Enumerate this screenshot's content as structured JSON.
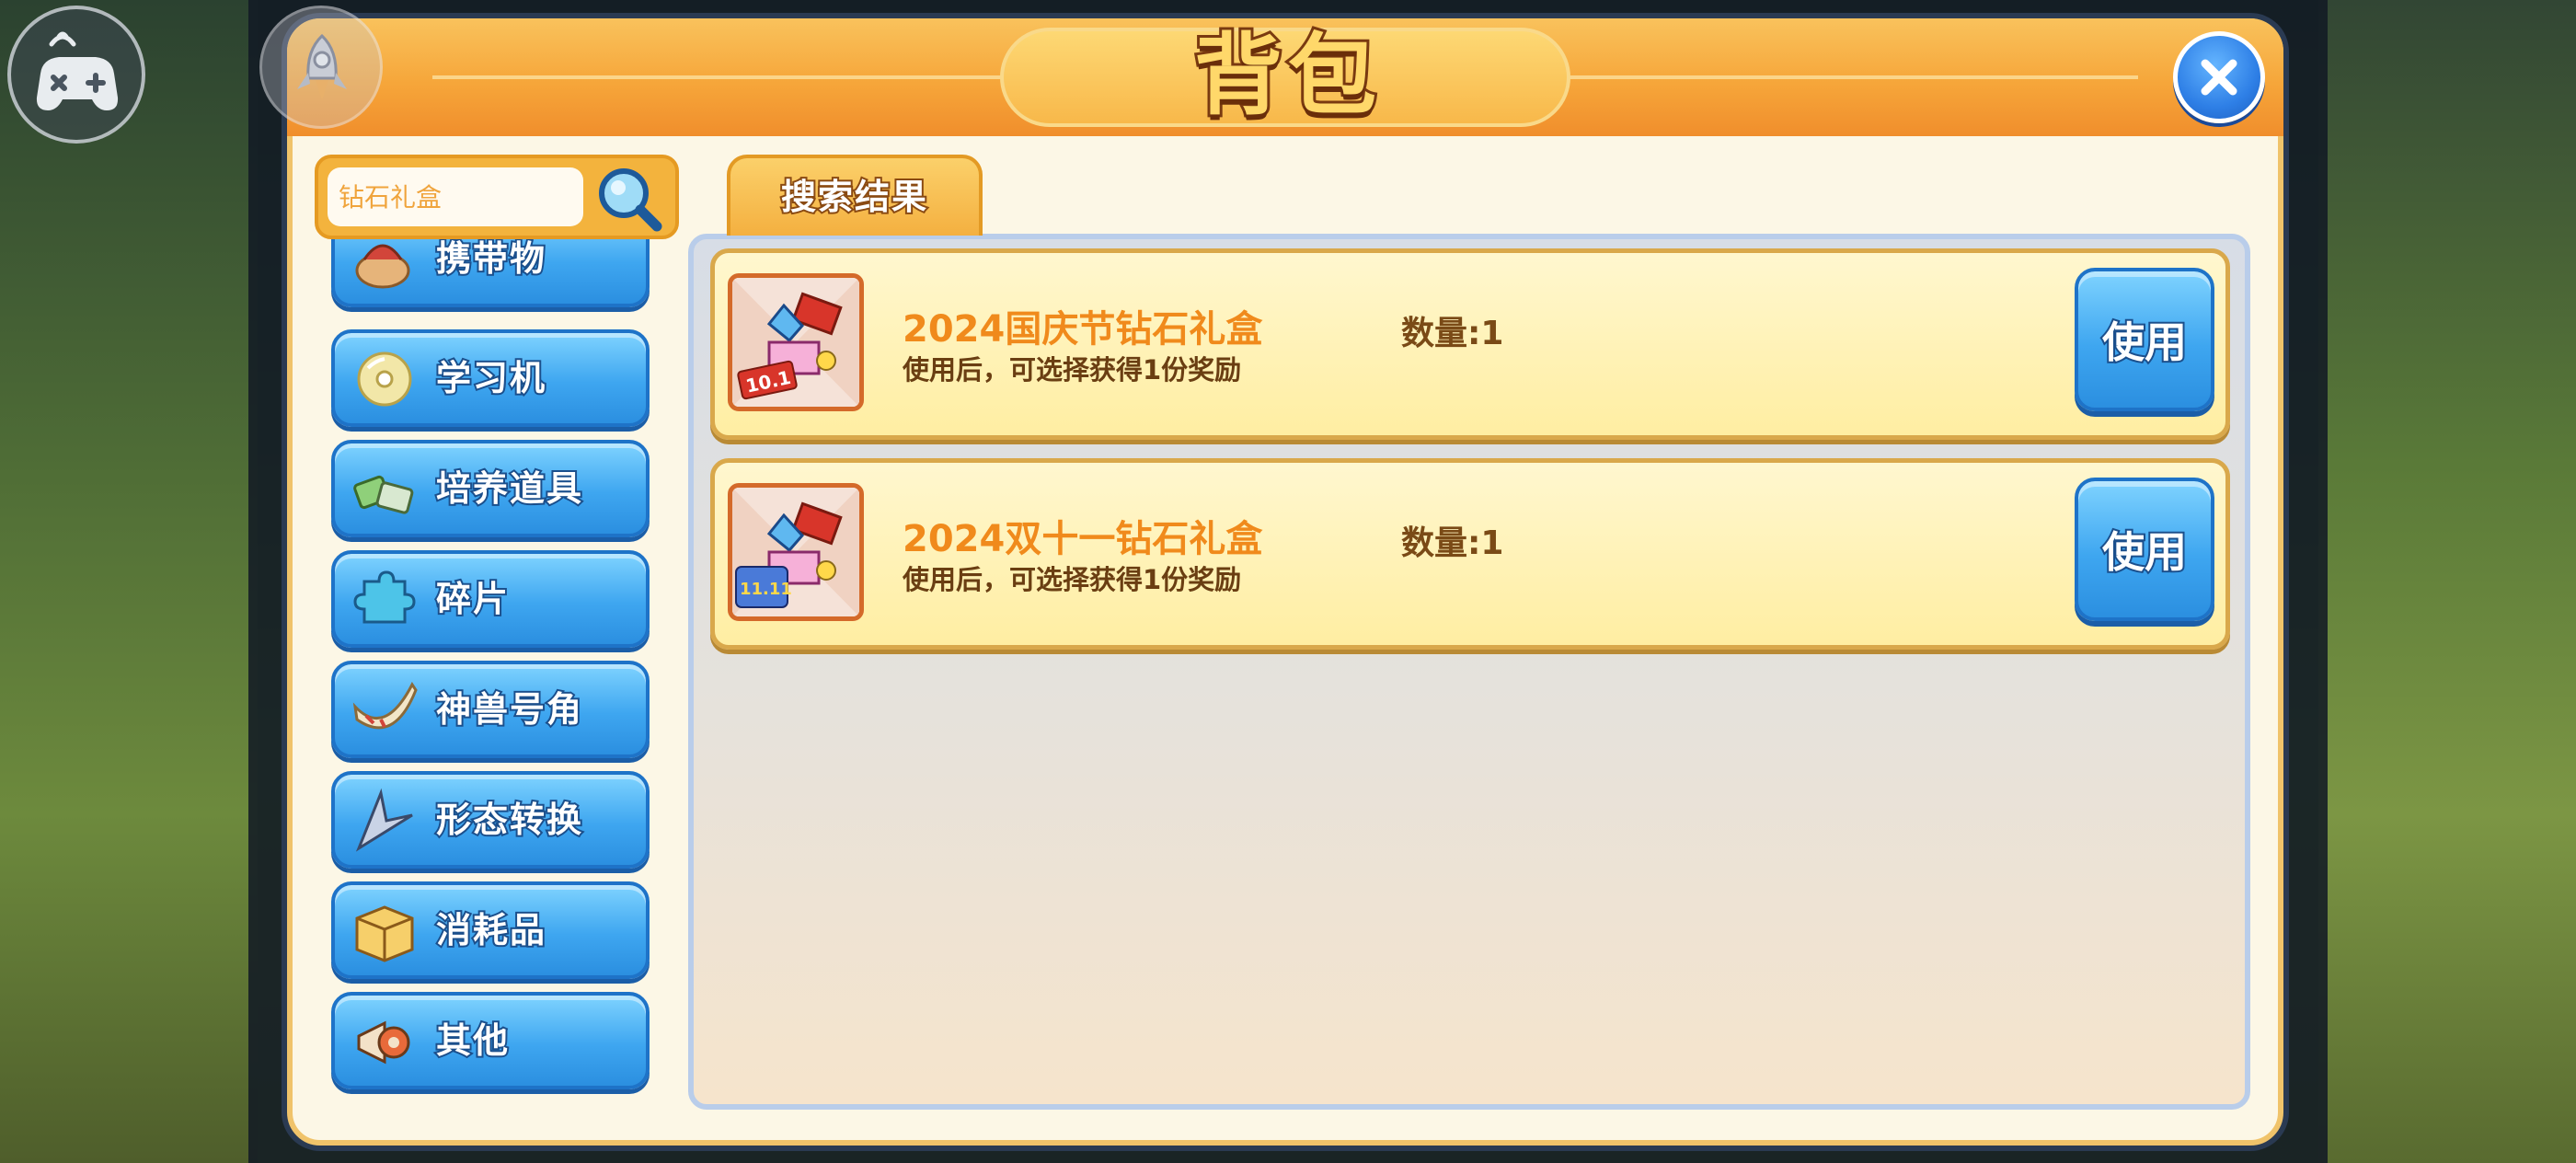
{
  "header": {
    "title": "背包",
    "close_icon": "close-icon"
  },
  "hud": {
    "gamepad_icon": "gamepad-icon",
    "rocket_icon": "rocket-icon"
  },
  "search": {
    "placeholder": "钻石礼盒",
    "value": "",
    "icon": "magnifier-icon"
  },
  "tabs": [
    {
      "label": "搜索结果",
      "active": true
    }
  ],
  "categories": [
    {
      "label": "携带物",
      "icon": "carry-item-icon"
    },
    {
      "label": "学习机",
      "icon": "disc-icon"
    },
    {
      "label": "培养道具",
      "icon": "training-item-icon"
    },
    {
      "label": "碎片",
      "icon": "puzzle-piece-icon"
    },
    {
      "label": "神兽号角",
      "icon": "horn-icon"
    },
    {
      "label": "形态转换",
      "icon": "transform-icon"
    },
    {
      "label": "消耗品",
      "icon": "box-icon"
    },
    {
      "label": "其他",
      "icon": "megaphone-icon"
    }
  ],
  "items": [
    {
      "name": "2024国庆节钻石礼盒",
      "description": "使用后，可选择获得1份奖励",
      "quantity": "数量:1",
      "badge": "10.1",
      "use_label": "使用",
      "icon": "gift-box-icon"
    },
    {
      "name": "2024双十一钻石礼盒",
      "description": "使用后，可选择获得1份奖励",
      "quantity": "数量:1",
      "badge": "11.11",
      "use_label": "使用",
      "icon": "gift-box-icon"
    }
  ],
  "colors": {
    "header_orange": "#f6a63a",
    "button_blue": "#3ea6f0",
    "item_title_orange": "#f08a1c",
    "item_row_yellow": "#ffeea2"
  }
}
